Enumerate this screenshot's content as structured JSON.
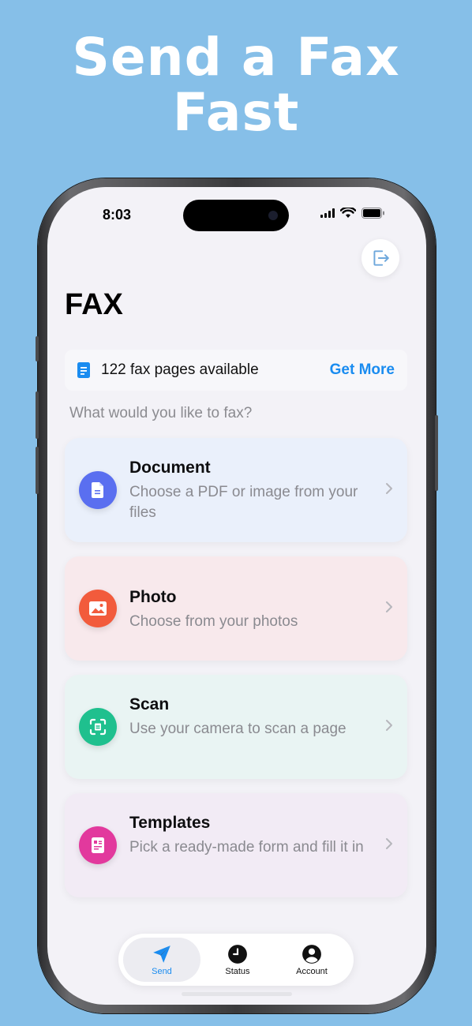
{
  "headline": {
    "line1": "Send a Fax",
    "line2": "Fast"
  },
  "status_bar": {
    "time": "8:03"
  },
  "header": {
    "title": "FAX",
    "logout_icon": "logout-icon"
  },
  "credits": {
    "count_text": "122 fax pages available",
    "action_label": "Get More",
    "icon": "document-icon"
  },
  "prompt": "What would you like to fax?",
  "options": [
    {
      "title": "Document",
      "description": "Choose a PDF or image from your files",
      "icon": "file-icon",
      "color": "#5a6ff0",
      "bg": "#eaf0fb"
    },
    {
      "title": "Photo",
      "description": "Choose from your photos",
      "icon": "image-icon",
      "color": "#f25b3c",
      "bg": "#f8e9ec"
    },
    {
      "title": "Scan",
      "description": "Use your camera to scan a page",
      "icon": "scan-icon",
      "color": "#1fc08e",
      "bg": "#e9f4f3"
    },
    {
      "title": "Templates",
      "description": "Pick a ready-made form and fill it in",
      "icon": "template-icon",
      "color": "#e2399d",
      "bg": "#f2ebf5"
    }
  ],
  "tabbar": {
    "items": [
      {
        "label": "Send",
        "icon": "paper-plane-icon",
        "active": true
      },
      {
        "label": "Status",
        "icon": "clock-icon",
        "active": false
      },
      {
        "label": "Account",
        "icon": "person-icon",
        "active": false
      }
    ]
  },
  "colors": {
    "background": "#86bfe8",
    "accent": "#1a8cf0"
  }
}
